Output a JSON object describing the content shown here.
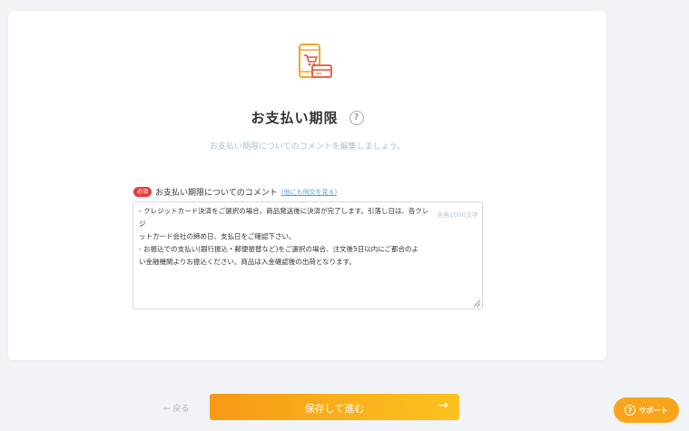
{
  "card": {
    "title": "お支払い期限",
    "help_glyph": "?",
    "subtitle": "お支払い期限についてのコメントを編集しましょう。",
    "field": {
      "required_badge": "必須",
      "label": "お支払い期限についてのコメント",
      "example_link": "(他にも例文を見る)",
      "value_lines": [
        "- クレジットカード決済をご選択の場合、商品発送後に決済が完了します。引落し日は、各クレジ",
        "ットカード会社の締め日、支払日をご確認下さい。",
        "- お振込での支払い(銀行振込・郵便振替など)をご選択の場合、注文後5日以内にご都合のよ",
        "い金融機関よりお振込ください。商品は入金確認後の出荷となります。"
      ],
      "char_limit": "全角1000文字"
    }
  },
  "footer": {
    "back_label": "← 戻る",
    "save_label": "保存して進む",
    "save_arrow": "→"
  },
  "support": {
    "icon_glyph": "?",
    "label": "サポート"
  },
  "colors": {
    "accent_orange": "#f79a15",
    "accent_yellow": "#fcc21f",
    "required_red": "#e63b3b",
    "link_blue": "#5aa0dc"
  }
}
